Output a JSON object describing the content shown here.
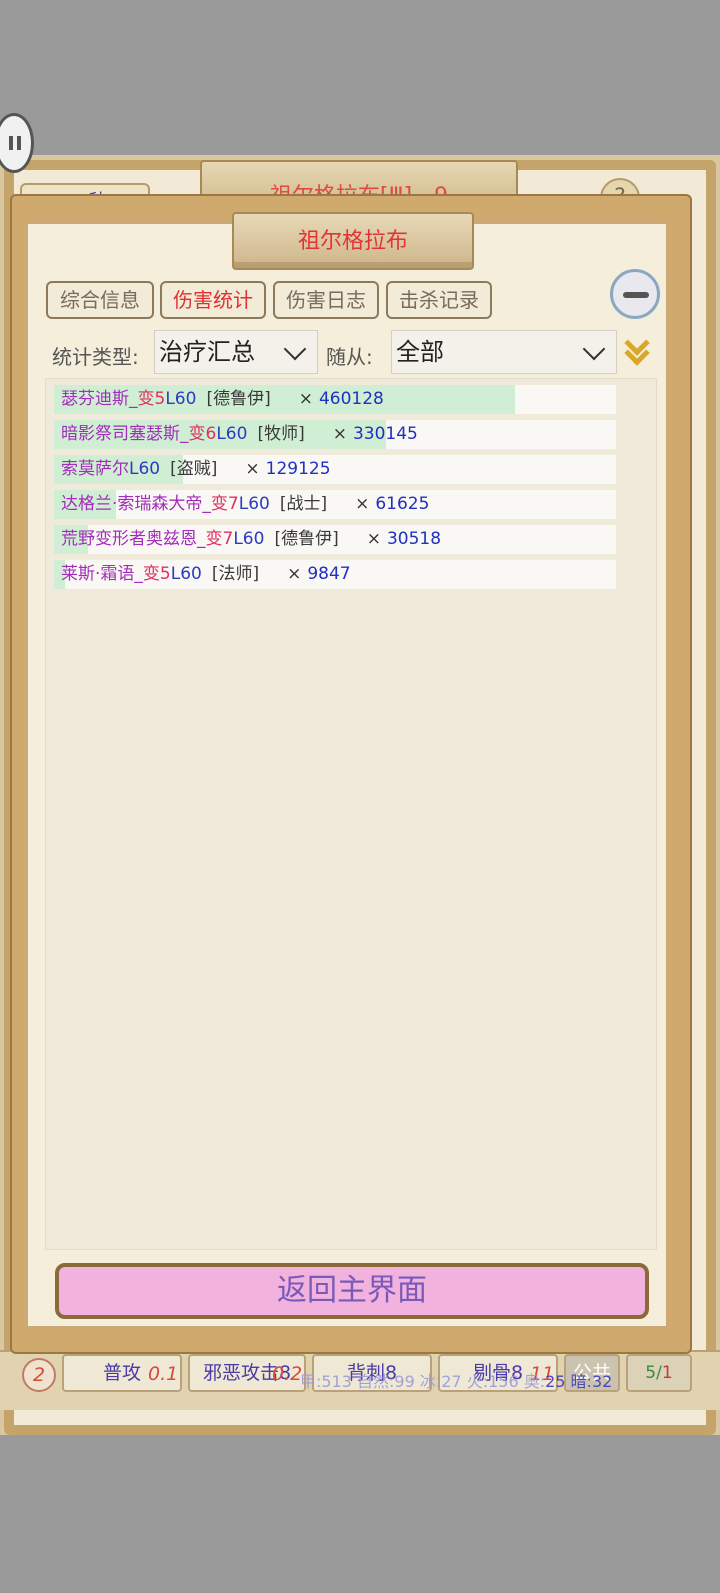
{
  "background": {
    "timer": "53 秒",
    "title": "祖尔格拉布[Ⅲ] - 9",
    "help_label": "?"
  },
  "modal": {
    "title": "祖尔格拉布",
    "tabs": [
      {
        "label": "综合信息",
        "active": false
      },
      {
        "label": "伤害统计",
        "active": true
      },
      {
        "label": "伤害日志",
        "active": false
      },
      {
        "label": "击杀记录",
        "active": false
      }
    ],
    "filters": {
      "type_label": "统计类型:",
      "type_value": "治疗汇总",
      "follower_label": "随从:",
      "follower_value": "全部"
    },
    "rows": [
      {
        "name": "瑟芬迪斯_",
        "tag": "变5",
        "level": "L60",
        "class": "[德鲁伊]",
        "times": "×",
        "value": "460128",
        "ratio": 0.82
      },
      {
        "name": "暗影祭司塞瑟斯_",
        "tag": "变6",
        "level": "L60",
        "class": "[牧师]",
        "times": "×",
        "value": "330145",
        "ratio": 0.59
      },
      {
        "name": "索莫萨尔",
        "tag": "",
        "level": "L60",
        "class": "[盗贼]",
        "times": "×",
        "value": "129125",
        "ratio": 0.23
      },
      {
        "name": "达格兰·索瑞森大帝_",
        "tag": "变7",
        "level": "L60",
        "class": "[战士]",
        "times": "×",
        "value": "61625",
        "ratio": 0.11
      },
      {
        "name": "荒野变形者奥兹恩_",
        "tag": "变7",
        "level": "L60",
        "class": "[德鲁伊]",
        "times": "×",
        "value": "30518",
        "ratio": 0.06
      },
      {
        "name": "莱斯·霜语_",
        "tag": "变5",
        "level": "L60",
        "class": "[法师]",
        "times": "×",
        "value": "9847",
        "ratio": 0.02
      }
    ],
    "return_label": "返回主界面"
  },
  "skill_bar": {
    "energy": "2",
    "skills": [
      {
        "label": "普攻",
        "cost": "0.1"
      },
      {
        "label": "邪恶攻击8",
        "cost": "0.2"
      },
      {
        "label": "背刺8",
        "cost": ""
      },
      {
        "label": "剔骨8",
        "cost": "11"
      },
      {
        "label": "公共",
        "cost": ""
      }
    ],
    "elements_light": "甲:513 自然:99 冰:27 火:156 奥:",
    "elements_dark": "25 暗:32",
    "page_current": "5",
    "page_sep": "/",
    "page_total": "1"
  },
  "colors": {
    "tab_active": "#e03030",
    "level": "#2c3cc0",
    "name": "#a32dbb",
    "bar_fill": "#cfeed3",
    "return_button": "#f2b2de"
  }
}
